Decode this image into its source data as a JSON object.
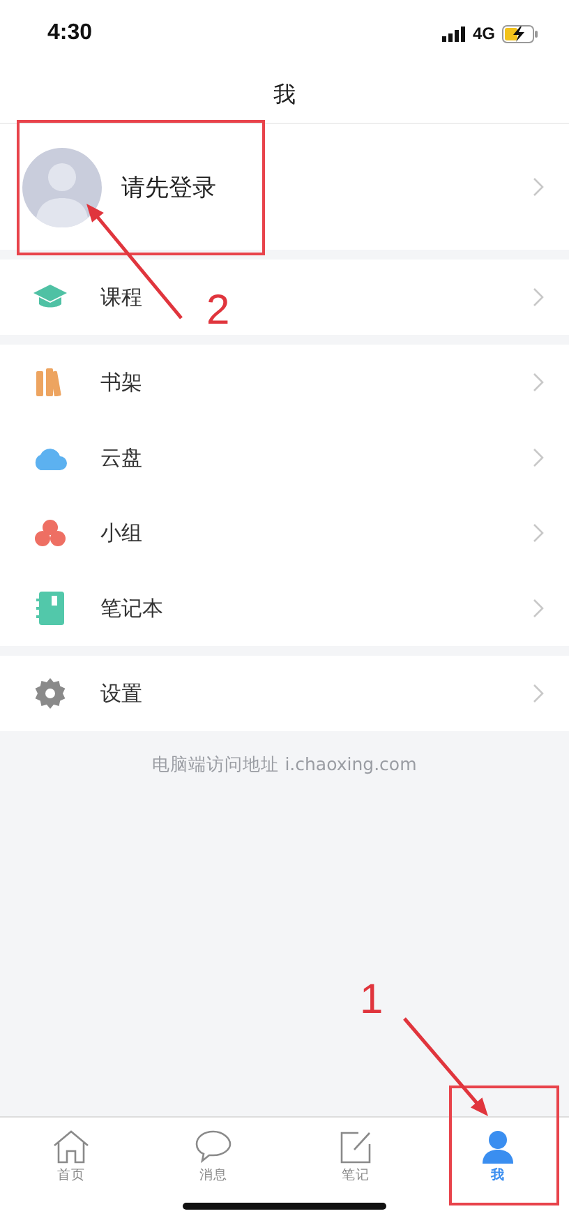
{
  "status_bar": {
    "time": "4:30",
    "network": "4G"
  },
  "header": {
    "title": "我"
  },
  "profile": {
    "label": "请先登录"
  },
  "sections": [
    {
      "items": [
        {
          "kind": "course",
          "label": "课程"
        }
      ]
    },
    {
      "items": [
        {
          "kind": "shelf",
          "label": "书架"
        },
        {
          "kind": "cloud",
          "label": "云盘"
        },
        {
          "kind": "group",
          "label": "小组"
        },
        {
          "kind": "notebook",
          "label": "笔记本"
        }
      ]
    },
    {
      "items": [
        {
          "kind": "settings",
          "label": "设置"
        }
      ]
    }
  ],
  "footer_note": "电脑端访问地址 i.chaoxing.com",
  "tabs": [
    {
      "kind": "home",
      "label": "首页",
      "selected": false
    },
    {
      "kind": "message",
      "label": "消息",
      "selected": false
    },
    {
      "kind": "note",
      "label": "笔记",
      "selected": false
    },
    {
      "kind": "me",
      "label": "我",
      "selected": true
    }
  ],
  "annotations": [
    {
      "label": "2"
    },
    {
      "label": "1"
    }
  ]
}
